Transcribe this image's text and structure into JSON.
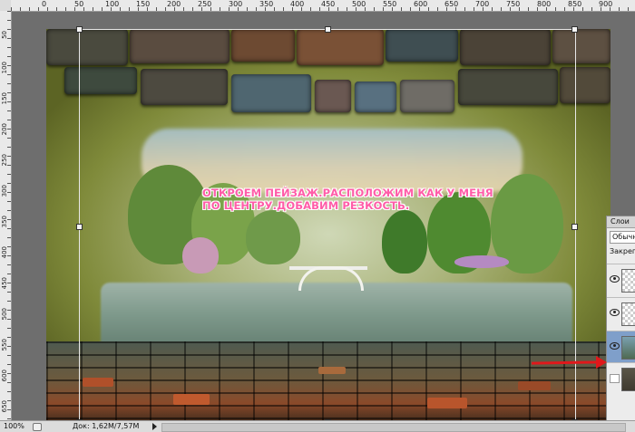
{
  "ruler": {
    "top_labels": [
      "0",
      "50",
      "100",
      "150",
      "200",
      "250",
      "300",
      "350",
      "400",
      "450",
      "500",
      "550",
      "600",
      "650",
      "700",
      "750",
      "800",
      "850",
      "900"
    ],
    "left_labels": [
      "50",
      "100",
      "150",
      "200",
      "250",
      "300",
      "350",
      "400",
      "450",
      "500",
      "550",
      "600",
      "650"
    ]
  },
  "canvas": {
    "overlay_text": "ОТКРОЕМ ПЕЙЗАЖ.РАСПОЛОЖИМ КАК У МЕНЯ ПО ЦЕНТРУ.ДОБАВИМ РЕЗКОСТЬ."
  },
  "layers_panel": {
    "title": "Слои",
    "blend_mode": "Обычн",
    "lock_label": "Закреп",
    "layers": [
      {
        "selected": false,
        "visible": true
      },
      {
        "selected": false,
        "visible": true
      },
      {
        "selected": true,
        "visible": true
      },
      {
        "selected": false,
        "visible": false
      }
    ]
  },
  "annotation": {
    "arrow_color": "#e0181b"
  },
  "status": {
    "zoom": "100%",
    "doc": "Док: 1,62M/7,57M"
  },
  "colors": {
    "text_pink": "#ff5ca8",
    "selected_layer": "#7f9fca"
  }
}
